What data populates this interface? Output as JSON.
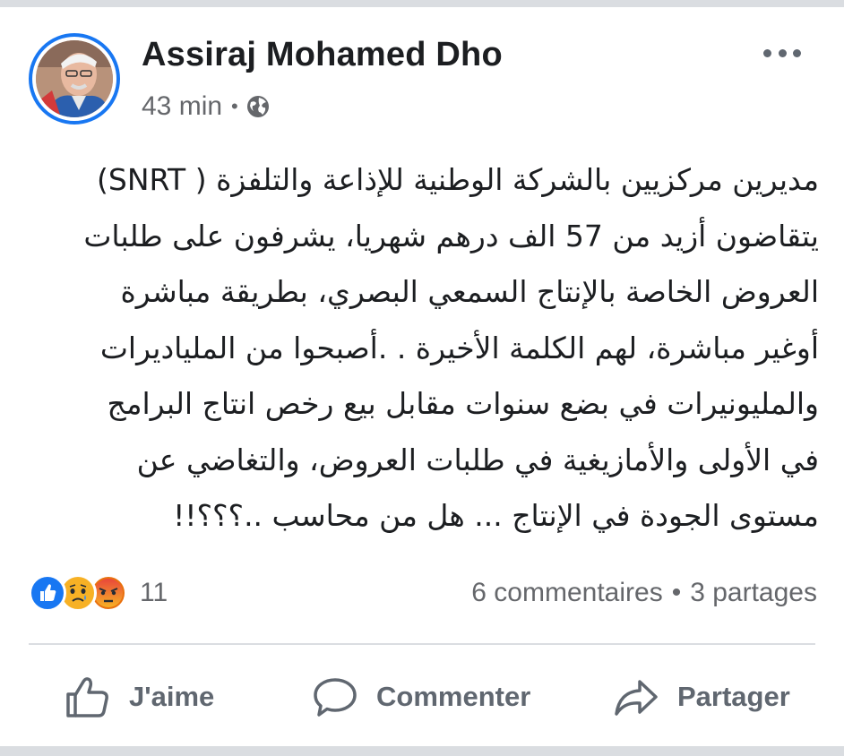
{
  "post": {
    "author": "Assiraj Mohamed Dho",
    "time": "43 min",
    "separator": "•",
    "privacy_icon": "globe-icon",
    "body_lines": [
      "مديرين مركزيين بالشركة الوطنية للإذاعة والتلفزة ( SNRT)",
      "يتقاضون أزيد من 57 الف درهم شهريا، يشرفون على طلبات",
      "العروض الخاصة بالإنتاج السمعي البصري، بطريقة مباشرة",
      "أوغير مباشرة، لهم الكلمة الأخيرة . .أصبحوا من الملياديرات",
      "والمليونيرات في بضع سنوات مقابل بيع رخص انتاج البرامج",
      "في الأولى والأمازيغية في طلبات العروض، والتغاضي عن",
      "مستوى الجودة في الإنتاج ... هل من محاسب ..؟؟؟!!"
    ]
  },
  "reactions": {
    "icons": [
      "like-icon",
      "sad-icon",
      "angry-icon"
    ],
    "count": "11"
  },
  "stats": {
    "comments": "6 commentaires",
    "separator": "•",
    "shares": "3 partages"
  },
  "actions": {
    "like_label": "J'aime",
    "comment_label": "Commenter",
    "share_label": "Partager"
  },
  "colors": {
    "accent": "#1877f2",
    "text": "#1c1e21",
    "secondary": "#65676b",
    "like": "#1877f2",
    "sad": "#f7b125",
    "angry": "#e9710f"
  }
}
